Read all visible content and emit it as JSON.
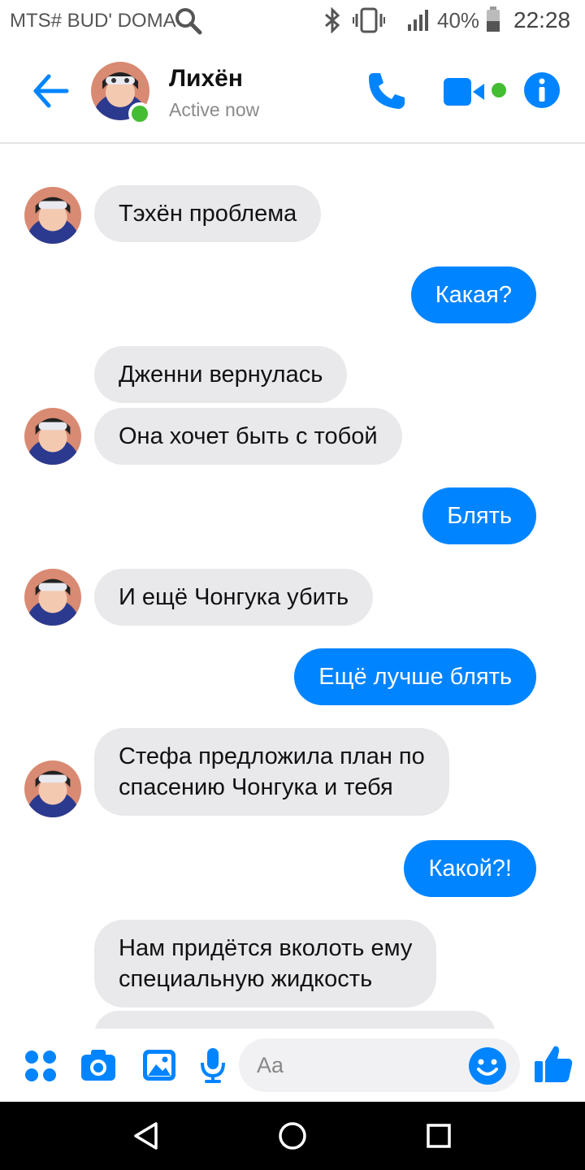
{
  "status_bar": {
    "carrier": "MTS# BUD' DOMA",
    "battery": "40%",
    "time": "22:28"
  },
  "header": {
    "name": "Лихён",
    "status": "Active now"
  },
  "messages": [
    {
      "side": "in",
      "text": "Тэхён проблема"
    },
    {
      "side": "out",
      "text": "Какая?"
    },
    {
      "side": "in",
      "text": "Дженни вернулась"
    },
    {
      "side": "in",
      "text": "Она хочет быть с тобой"
    },
    {
      "side": "out",
      "text": "Блять"
    },
    {
      "side": "in",
      "text": "И ещё Чонгука убить"
    },
    {
      "side": "out",
      "text": "Ещё лучше блять"
    },
    {
      "side": "in",
      "text": "Стефа предложила план по\nспасению Чонгука и тебя"
    },
    {
      "side": "out",
      "text": "Какой?!"
    },
    {
      "side": "in",
      "text": "Нам придётся вколоть ему\nспециальную жидкость"
    }
  ],
  "composer": {
    "placeholder": "Aa"
  },
  "icons": {
    "header": [
      "back-arrow-icon",
      "phone-icon",
      "video-camera-icon",
      "info-icon"
    ],
    "composer": [
      "apps-grid-icon",
      "camera-icon",
      "gallery-icon",
      "microphone-icon",
      "emoji-icon",
      "thumbs-up-icon"
    ],
    "navbar": [
      "back-triangle-icon",
      "home-circle-icon",
      "recents-square-icon"
    ]
  },
  "colors": {
    "accent": "#0084ff",
    "incoming_bubble": "#e9e9ec",
    "online": "#44bd32"
  }
}
